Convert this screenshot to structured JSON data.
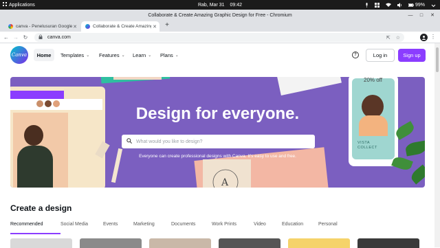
{
  "system_bar": {
    "apps_label": "Applications",
    "date": "Rab, Mar 31",
    "time": "09:42",
    "battery": "99%"
  },
  "window": {
    "title": "Collaborate & Create Amazing Graphic Design for Free - Chromium"
  },
  "tabs": [
    {
      "label": "canva - Penelusuran Google",
      "active": false
    },
    {
      "label": "Collaborate & Create Amazing",
      "active": true
    }
  ],
  "address_bar": {
    "url": "canva.com"
  },
  "header": {
    "logo_text": "Canva",
    "nav": {
      "home": "Home",
      "templates": "Templates",
      "features": "Features",
      "learn": "Learn",
      "plans": "Plans"
    },
    "login": "Log in",
    "signup": "Sign up"
  },
  "hero": {
    "title": "Design for everyone.",
    "search_placeholder": "What would you like to design?",
    "subtitle": "Everyone can create professional designs with Canva. It's easy to use and free.",
    "promo_badge": "20% off",
    "card_text": "VISTA COLLECT"
  },
  "section": {
    "title": "Create a design",
    "categories": [
      "Recommended",
      "Social Media",
      "Events",
      "Marketing",
      "Documents",
      "Work Prints",
      "Video",
      "Education",
      "Personal"
    ]
  },
  "colors": {
    "accent": "#8b3dff",
    "hero_bg": "#7b5fc0"
  }
}
